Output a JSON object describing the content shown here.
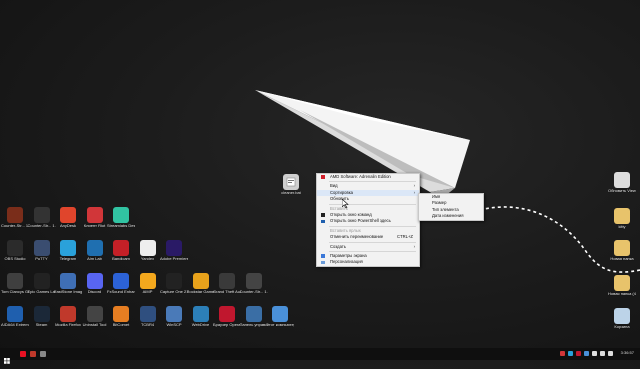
{
  "desktop": {
    "left_icons": [
      {
        "label": "Counter-Str... 1.6 RBN (R...",
        "icon": "cs-ranks-icon",
        "color": "#7a2d1a"
      },
      {
        "label": "Counter-Str... 1.6 RGS",
        "icon": "counter-strike-icon",
        "color": "#333333"
      },
      {
        "label": "AnyDesk",
        "icon": "anydesk-icon",
        "color": "#e0452c"
      },
      {
        "label": "Клиент Riot",
        "icon": "riot-icon",
        "color": "#d13639"
      },
      {
        "label": "Streamlabs Desktop",
        "icon": "streamlabs-icon",
        "color": "#31c3a2"
      },
      {
        "label": "OBS Studio",
        "icon": "obs-icon",
        "color": "#2b2b2b"
      },
      {
        "label": "PuTTY",
        "icon": "putty-icon",
        "color": "#3a4d70"
      },
      {
        "label": "Telegram",
        "icon": "telegram-icon",
        "color": "#2aa1da"
      },
      {
        "label": "Aim Lab",
        "icon": "aimlab-icon",
        "color": "#1f6fb0"
      },
      {
        "label": "Bandicam",
        "icon": "bandicam-icon",
        "color": "#c42027"
      },
      {
        "label": "Yandex",
        "icon": "yandex-icon",
        "color": "#eeeeee"
      },
      {
        "label": "Adobe Premiere P...",
        "icon": "premiere-icon",
        "color": "#2a1a66"
      },
      {
        "label": "Tom Clancys Ghost Rec...",
        "icon": "ghost-recon-icon",
        "color": "#3f3f3f"
      },
      {
        "label": "Epic Games Launcher",
        "icon": "epic-icon",
        "color": "#222222"
      },
      {
        "label": "FastStone Image Viewer",
        "icon": "faststone-icon",
        "color": "#3f6fb5"
      },
      {
        "label": "Discord",
        "icon": "discord-icon",
        "color": "#5865f2"
      },
      {
        "label": "FxSound Enhancer",
        "icon": "fxsound-icon",
        "color": "#2c62d6"
      },
      {
        "label": "AIMP",
        "icon": "aimp-icon",
        "color": "#f4a81d"
      },
      {
        "label": "Capture One 21",
        "icon": "capture-one-icon",
        "color": "#222222"
      },
      {
        "label": "Rockstar Games...",
        "icon": "rockstar-icon",
        "color": "#e8a21b"
      },
      {
        "label": "Grand Theft Auto V",
        "icon": "gta-icon",
        "color": "#3a3a3a"
      },
      {
        "label": "Counter-Str... 1.6 RGS",
        "icon": "counter-strike-icon",
        "color": "#444444"
      },
      {
        "label": "AIDA64 Extreme",
        "icon": "aida64-icon",
        "color": "#1f5fae"
      },
      {
        "label": "Steam",
        "icon": "steam-icon",
        "color": "#1b2838"
      },
      {
        "label": "Mozilla Firefox",
        "icon": "firefox-icon",
        "color": "#c0392b"
      },
      {
        "label": "Uninstall Tool",
        "icon": "uninstall-tool-icon",
        "color": "#444444"
      },
      {
        "label": "BitComet",
        "icon": "bitcomet-icon",
        "color": "#e67e22"
      },
      {
        "label": "TCBR4",
        "icon": "tcbr4-icon",
        "color": "#2f4f7f"
      },
      {
        "label": "WinSCP",
        "icon": "winscp-icon",
        "color": "#4a7ab8"
      },
      {
        "label": "WebDrive",
        "icon": "webdrive-icon",
        "color": "#2c7fb8"
      },
      {
        "label": "Браузер Opera GX",
        "icon": "opera-gx-icon",
        "color": "#c0172e"
      },
      {
        "label": "Панель управления",
        "icon": "control-panel-icon",
        "color": "#3a6ea5"
      },
      {
        "label": "Этот компьютер",
        "icon": "this-pc-icon",
        "color": "#4a90d9"
      }
    ],
    "file_icon": {
      "label": "cleaner.bat",
      "icon": "bat-file-icon"
    },
    "right_icons": [
      {
        "label": "Обновить View De...",
        "icon": "refresh-icon",
        "color": "#dddddd"
      },
      {
        "label": "kitty",
        "icon": "folder-icon",
        "color": "#e8c36b"
      },
      {
        "label": "Новая папка",
        "icon": "folder-icon",
        "color": "#e8c36b"
      },
      {
        "label": "Новая папка (4)",
        "icon": "folder-icon",
        "color": "#e8c36b"
      },
      {
        "label": "Корзина",
        "icon": "recycle-bin-icon",
        "color": "#bcd3e8"
      }
    ]
  },
  "context_menu": {
    "items": [
      {
        "label": "AMD Software: Adrenalin Edition",
        "icon": "amd-icon",
        "state": "normal"
      },
      {
        "sep": true
      },
      {
        "label": "Вид",
        "arrow": true,
        "state": "normal"
      },
      {
        "label": "Сортировка",
        "arrow": true,
        "state": "highlight"
      },
      {
        "label": "Обновить",
        "state": "normal"
      },
      {
        "sep": true
      },
      {
        "label": "Вставить",
        "state": "disabled"
      },
      {
        "label": "Открыть окно команд",
        "icon": "cmd-icon",
        "state": "normal"
      },
      {
        "label": "Открыть окно PowerShell здесь",
        "icon": "powershell-icon",
        "state": "normal"
      },
      {
        "sep": true
      },
      {
        "label": "Вставить ярлык",
        "state": "disabled"
      },
      {
        "label": "Отменить переименование",
        "shortcut": "CTRL+Z",
        "state": "normal"
      },
      {
        "sep": true
      },
      {
        "label": "Создать",
        "arrow": true,
        "state": "normal"
      },
      {
        "sep": true
      },
      {
        "label": "Параметры экрана",
        "icon": "display-icon",
        "state": "normal"
      },
      {
        "label": "Персонализация",
        "icon": "personalize-icon",
        "state": "normal"
      }
    ]
  },
  "submenu": {
    "items": [
      "Имя",
      "Размер",
      "Тип элемента",
      "Дата изменения"
    ]
  },
  "taskbar": {
    "time": "3:36:57",
    "date": "",
    "pinned_colors": [
      "#e81123",
      "#c0392b",
      "#888888"
    ],
    "tray_colors": [
      "#d13639",
      "#2aa1da",
      "#c0172e",
      "#4a90d9",
      "#dddddd",
      "#dddddd",
      "#dddddd"
    ]
  }
}
